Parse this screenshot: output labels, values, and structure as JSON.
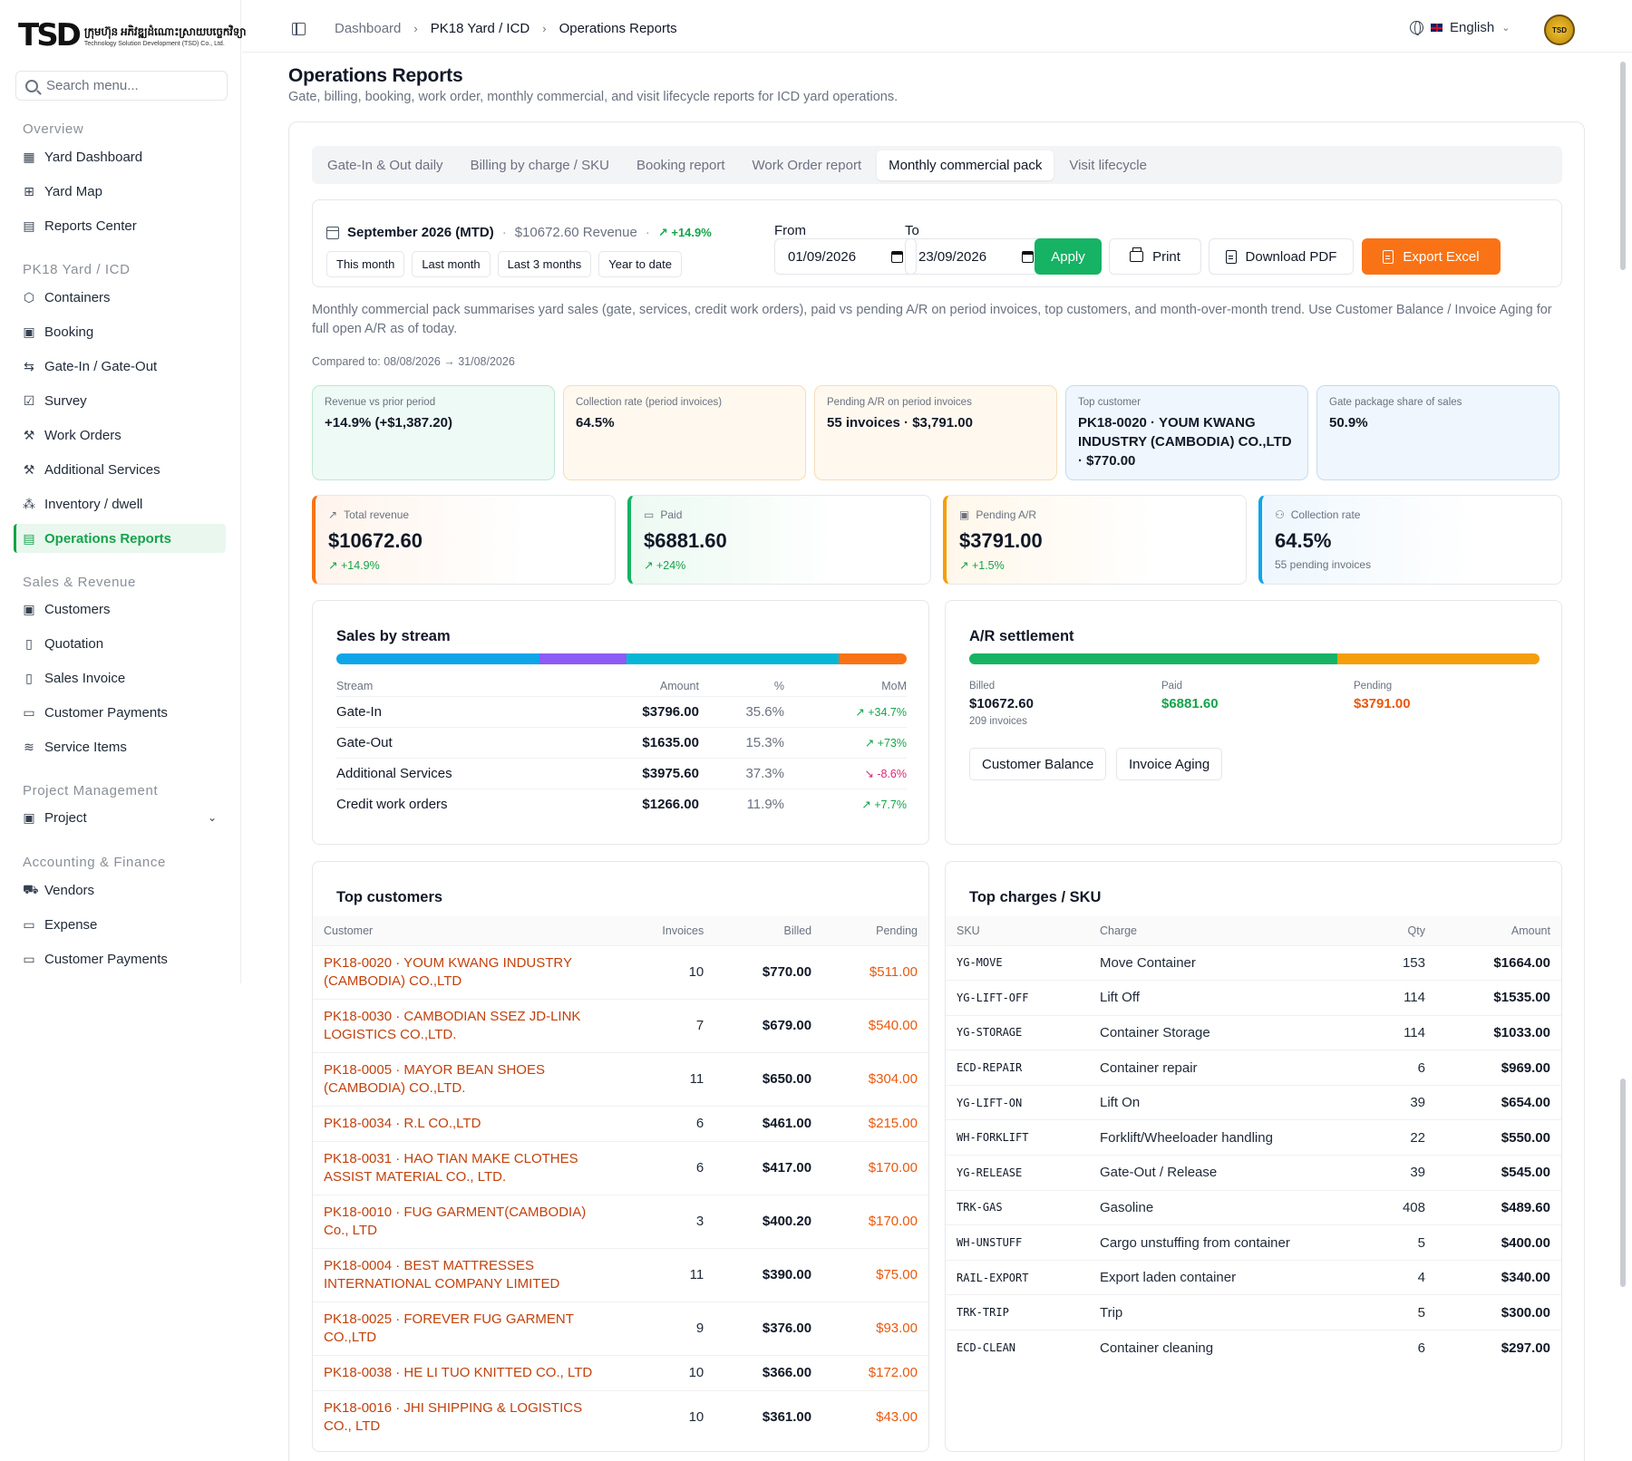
{
  "sidebar": {
    "logo_mark": "TSD",
    "logo_kh": "ក្រុមហ៊ុន អភិវឌ្ឍដំណោះស្រាយបច្ចេកវិទ្យា",
    "logo_en": "Technology Solution Development (TSD) Co., Ltd.",
    "search_placeholder": "Search menu...",
    "sections": {
      "overview": "Overview",
      "yard": "PK18 Yard / ICD",
      "sales": "Sales & Revenue",
      "project": "Project Management",
      "accounting": "Accounting & Finance"
    },
    "items": {
      "yard_dashboard": "Yard Dashboard",
      "yard_map": "Yard Map",
      "reports_center": "Reports Center",
      "containers": "Containers",
      "booking": "Booking",
      "gate": "Gate-In / Gate-Out",
      "survey": "Survey",
      "work_orders": "Work Orders",
      "additional_services": "Additional Services",
      "inventory": "Inventory / dwell",
      "operations_reports": "Operations Reports",
      "customers": "Customers",
      "quotation": "Quotation",
      "sales_invoice": "Sales Invoice",
      "customer_payments": "Customer Payments",
      "service_items": "Service Items",
      "project": "Project",
      "vendors": "Vendors",
      "expense": "Expense",
      "customer_payments_2": "Customer Payments"
    }
  },
  "topbar": {
    "crumbs": [
      "Dashboard",
      "PK18 Yard / ICD",
      "Operations Reports"
    ],
    "language": "English",
    "avatar_text": "TSD"
  },
  "page": {
    "title": "Operations Reports",
    "subtitle": "Gate, billing, booking, work order, monthly commercial, and visit lifecycle reports for ICD yard operations."
  },
  "tabs": [
    "Gate-In & Out daily",
    "Billing by charge / SKU",
    "Booking report",
    "Work Order report",
    "Monthly commercial pack",
    "Visit lifecycle"
  ],
  "filter": {
    "period_name": "September 2026 (MTD)",
    "period_revenue": "$10672.60 Revenue",
    "period_change": "↗ +14.9%",
    "presets": [
      "This month",
      "Last month",
      "Last 3 months",
      "Year to date"
    ],
    "from_label": "From",
    "from_value": "01/09/2026",
    "to_label": "To",
    "to_value": "23/09/2026",
    "apply": "Apply",
    "print": "Print",
    "download_pdf": "Download PDF",
    "export_excel": "Export Excel"
  },
  "description": "Monthly commercial pack summarises yard sales (gate, services, credit work orders), paid vs pending A/R on period invoices, top customers, and month-over-month trend. Use Customer Balance / Invoice Aging for full open A/R as of today.",
  "compared_to": "Compared to: 08/08/2026 → 31/08/2026",
  "insights": [
    {
      "label": "Revenue vs prior period",
      "value": "+14.9% (+$1,387.20)"
    },
    {
      "label": "Collection rate (period invoices)",
      "value": "64.5%"
    },
    {
      "label": "Pending A/R on period invoices",
      "value": "55 invoices · $3,791.00"
    },
    {
      "label": "Top customer",
      "value": "PK18-0020 · YOUM KWANG INDUSTRY (CAMBODIA) CO.,LTD · $770.00"
    },
    {
      "label": "Gate package share of sales",
      "value": "50.9%"
    }
  ],
  "kpis": [
    {
      "label": "Total revenue",
      "value": "$10672.60",
      "change": "↗ +14.9%"
    },
    {
      "label": "Paid",
      "value": "$6881.60",
      "change": "↗ +24%"
    },
    {
      "label": "Pending A/R",
      "value": "$3791.00",
      "change": "↗ +1.5%"
    },
    {
      "label": "Collection rate",
      "value": "64.5%",
      "note": "55 pending invoices"
    }
  ],
  "sales_by_stream": {
    "title": "Sales by stream",
    "headers": [
      "Stream",
      "Amount",
      "%",
      "MoM"
    ],
    "rows": [
      {
        "stream": "Gate-In",
        "amount": "$3796.00",
        "pct": "35.6%",
        "mom": "↗ +34.7%",
        "share": 35.6,
        "color": "#0ea5e9"
      },
      {
        "stream": "Gate-Out",
        "amount": "$1635.00",
        "pct": "15.3%",
        "mom": "↗ +73%",
        "share": 15.3,
        "color": "#8b5cf6"
      },
      {
        "stream": "Additional Services",
        "amount": "$3975.60",
        "pct": "37.3%",
        "mom": "↘ -8.6%",
        "share": 37.3,
        "color": "#06b6d4"
      },
      {
        "stream": "Credit work orders",
        "amount": "$1266.00",
        "pct": "11.9%",
        "mom": "↗ +7.7%",
        "share": 11.9,
        "color": "#f97316"
      }
    ]
  },
  "ar_settlement": {
    "title": "A/R settlement",
    "paid_share": 64.5,
    "billed_label": "Billed",
    "billed_value": "$10672.60",
    "billed_note": "209 invoices",
    "paid_label": "Paid",
    "paid_value": "$6881.60",
    "pending_label": "Pending",
    "pending_value": "$3791.00",
    "btn_balance": "Customer Balance",
    "btn_aging": "Invoice Aging",
    "colors": {
      "paid": "#16b364",
      "pending": "#f59e0b"
    }
  },
  "top_customers": {
    "title": "Top customers",
    "headers": [
      "Customer",
      "Invoices",
      "Billed",
      "Pending"
    ],
    "rows": [
      {
        "name": "PK18-0020 · YOUM KWANG INDUSTRY (CAMBODIA) CO.,LTD",
        "invoices": "10",
        "billed": "$770.00",
        "pending": "$511.00"
      },
      {
        "name": "PK18-0030 · CAMBODIAN SSEZ JD-LINK LOGISTICS CO.,LTD.",
        "invoices": "7",
        "billed": "$679.00",
        "pending": "$540.00"
      },
      {
        "name": "PK18-0005 · MAYOR BEAN SHOES (CAMBODIA) CO.,LTD.",
        "invoices": "11",
        "billed": "$650.00",
        "pending": "$304.00"
      },
      {
        "name": "PK18-0034 · R.L CO.,LTD",
        "invoices": "6",
        "billed": "$461.00",
        "pending": "$215.00"
      },
      {
        "name": "PK18-0031 · HAO TIAN MAKE CLOTHES ASSIST MATERIAL CO., LTD.",
        "invoices": "6",
        "billed": "$417.00",
        "pending": "$170.00"
      },
      {
        "name": "PK18-0010 · FUG GARMENT(CAMBODIA) Co., LTD",
        "invoices": "3",
        "billed": "$400.20",
        "pending": "$170.00"
      },
      {
        "name": "PK18-0004 · BEST MATTRESSES INTERNATIONAL COMPANY LIMITED",
        "invoices": "11",
        "billed": "$390.00",
        "pending": "$75.00"
      },
      {
        "name": "PK18-0025 · FOREVER FUG GARMENT CO.,LTD",
        "invoices": "9",
        "billed": "$376.00",
        "pending": "$93.00"
      },
      {
        "name": "PK18-0038 · HE LI TUO KNITTED CO., LTD",
        "invoices": "10",
        "billed": "$366.00",
        "pending": "$172.00"
      },
      {
        "name": "PK18-0016 · JHI SHIPPING & LOGISTICS CO., LTD",
        "invoices": "10",
        "billed": "$361.00",
        "pending": "$43.00"
      }
    ]
  },
  "top_charges": {
    "title": "Top charges / SKU",
    "headers": [
      "SKU",
      "Charge",
      "Qty",
      "Amount"
    ],
    "rows": [
      {
        "sku": "YG-MOVE",
        "charge": "Move Container",
        "qty": "153",
        "amount": "$1664.00"
      },
      {
        "sku": "YG-LIFT-OFF",
        "charge": "Lift Off",
        "qty": "114",
        "amount": "$1535.00"
      },
      {
        "sku": "YG-STORAGE",
        "charge": "Container Storage",
        "qty": "114",
        "amount": "$1033.00"
      },
      {
        "sku": "ECD-REPAIR",
        "charge": "Container repair",
        "qty": "6",
        "amount": "$969.00"
      },
      {
        "sku": "YG-LIFT-ON",
        "charge": "Lift On",
        "qty": "39",
        "amount": "$654.00"
      },
      {
        "sku": "WH-FORKLIFT",
        "charge": "Forklift/Wheeloader handling",
        "qty": "22",
        "amount": "$550.00"
      },
      {
        "sku": "YG-RELEASE",
        "charge": "Gate-Out / Release",
        "qty": "39",
        "amount": "$545.00"
      },
      {
        "sku": "TRK-GAS",
        "charge": "Gasoline",
        "qty": "408",
        "amount": "$489.60"
      },
      {
        "sku": "WH-UNSTUFF",
        "charge": "Cargo unstuffing from container",
        "qty": "5",
        "amount": "$400.00"
      },
      {
        "sku": "RAIL-EXPORT",
        "charge": "Export laden container",
        "qty": "4",
        "amount": "$340.00"
      },
      {
        "sku": "TRK-TRIP",
        "charge": "Trip",
        "qty": "5",
        "amount": "$300.00"
      },
      {
        "sku": "ECD-CLEAN",
        "charge": "Container cleaning",
        "qty": "6",
        "amount": "$297.00"
      }
    ]
  },
  "colors": {
    "accent_green": "#16b364",
    "export_orange": "#f97316",
    "up": "#16a34a",
    "down": "#db2777"
  }
}
